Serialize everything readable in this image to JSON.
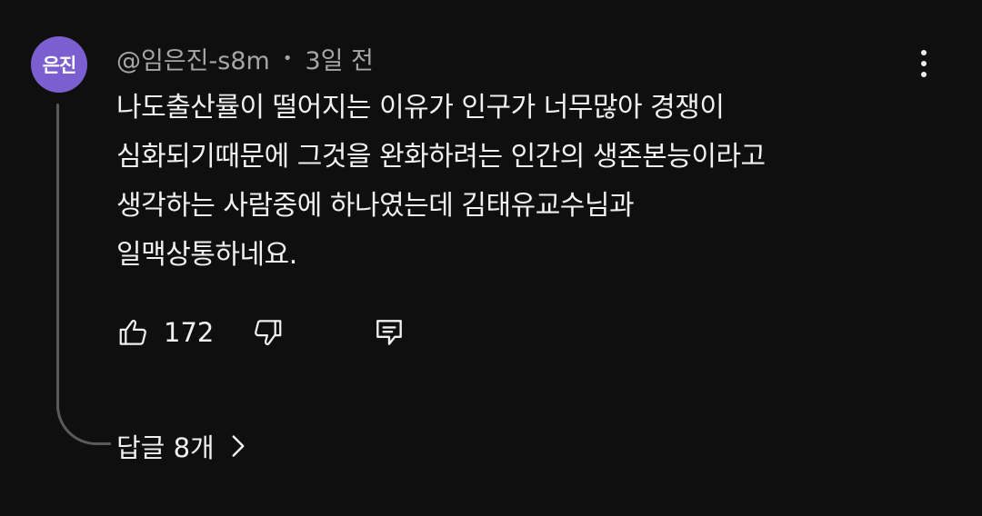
{
  "comment": {
    "avatar_text": "은진",
    "author": "@임은진-s8m",
    "separator": "•",
    "time": "3일 전",
    "text_lines": [
      "나도출산률이 떨어지는 이유가 인구가 너무많아 경쟁이",
      "심화되기때문에 그것을 완화하려는 인간의 생존본능이라고",
      "생각하는 사람중에 하나였는데 김태유교수님과",
      "일맥상통하네요."
    ],
    "like_count": "172",
    "replies_label": "답글 8개"
  },
  "icons": {
    "like": "thumb-up-icon",
    "dislike": "thumb-down-icon",
    "reply": "comment-icon",
    "more": "more-vert-icon",
    "chevron": "chevron-right-icon"
  },
  "colors": {
    "background": "#0f0f0f",
    "avatar": "#7b5fd1",
    "text": "#f1f1f1",
    "meta": "#a6a6a6"
  }
}
